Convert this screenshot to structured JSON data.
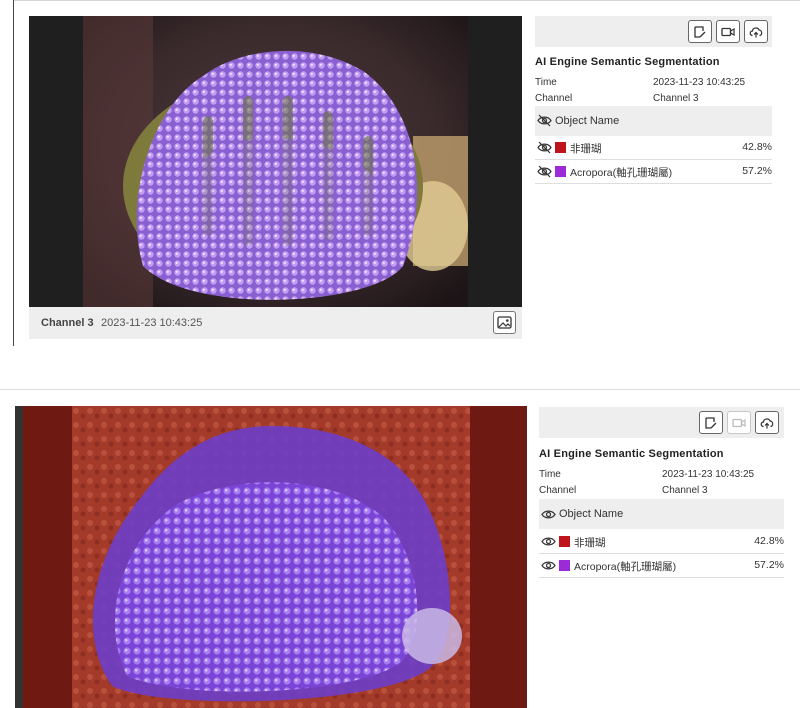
{
  "panels": [
    {
      "channel_label": "Channel 3",
      "timestamp": "2023-11-23 10:43:25",
      "side": {
        "title": "AI Engine Semantic Segmentation",
        "time_label": "Time",
        "time_value": "2023-11-23 10:43:25",
        "channel_label": "Channel",
        "channel_value": "Channel 3",
        "object_header": "Object Name",
        "overlay_visible": false,
        "video_button_enabled": true,
        "objects": [
          {
            "name": "非珊瑚",
            "color": "#c0141c",
            "percent": "42.8%"
          },
          {
            "name": "Acropora(軸孔珊瑚屬)",
            "color": "#9b2bd6",
            "percent": "57.2%"
          }
        ]
      }
    },
    {
      "side": {
        "title": "AI Engine Semantic Segmentation",
        "time_label": "Time",
        "time_value": "2023-11-23 10:43:25",
        "channel_label": "Channel",
        "channel_value": "Channel 3",
        "object_header": "Object Name",
        "overlay_visible": true,
        "video_button_enabled": false,
        "objects": [
          {
            "name": "非珊瑚",
            "color": "#c0141c",
            "percent": "42.8%"
          },
          {
            "name": "Acropora(軸孔珊瑚屬)",
            "color": "#9b2bd6",
            "percent": "57.2%"
          }
        ]
      }
    }
  ],
  "icons": {
    "note": "note-edit-icon",
    "video": "video-camera-icon",
    "cloud": "cloud-upload-icon",
    "snapshot": "image-snapshot-icon",
    "visible": "eye-icon",
    "hidden": "eye-off-icon"
  }
}
